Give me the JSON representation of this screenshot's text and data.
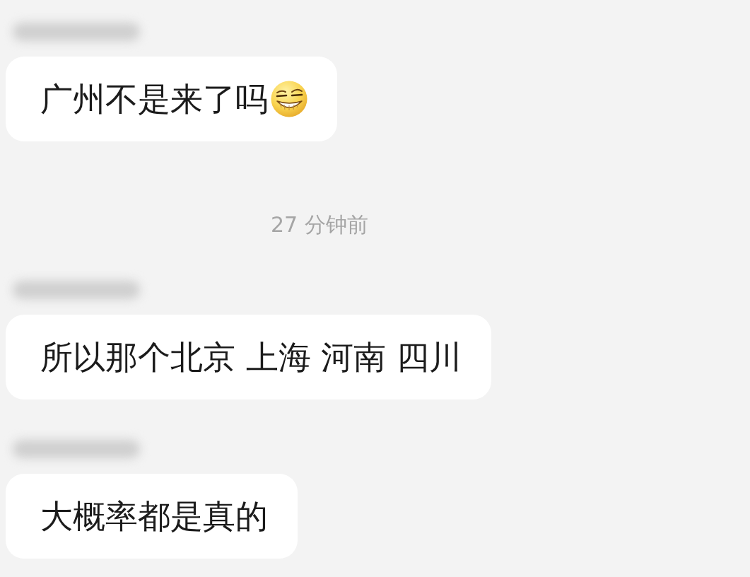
{
  "chat": {
    "items": [
      {
        "kind": "message",
        "sender_hidden": true,
        "text": "广州不是来了吗",
        "trailing_emoji": true
      },
      {
        "kind": "time",
        "text": "27 分钟前"
      },
      {
        "kind": "message",
        "sender_hidden": true,
        "text": "所以那个北京 上海 河南 四川",
        "trailing_emoji": false
      },
      {
        "kind": "message",
        "sender_hidden": true,
        "text": "大概率都是真的",
        "trailing_emoji": false
      }
    ]
  }
}
